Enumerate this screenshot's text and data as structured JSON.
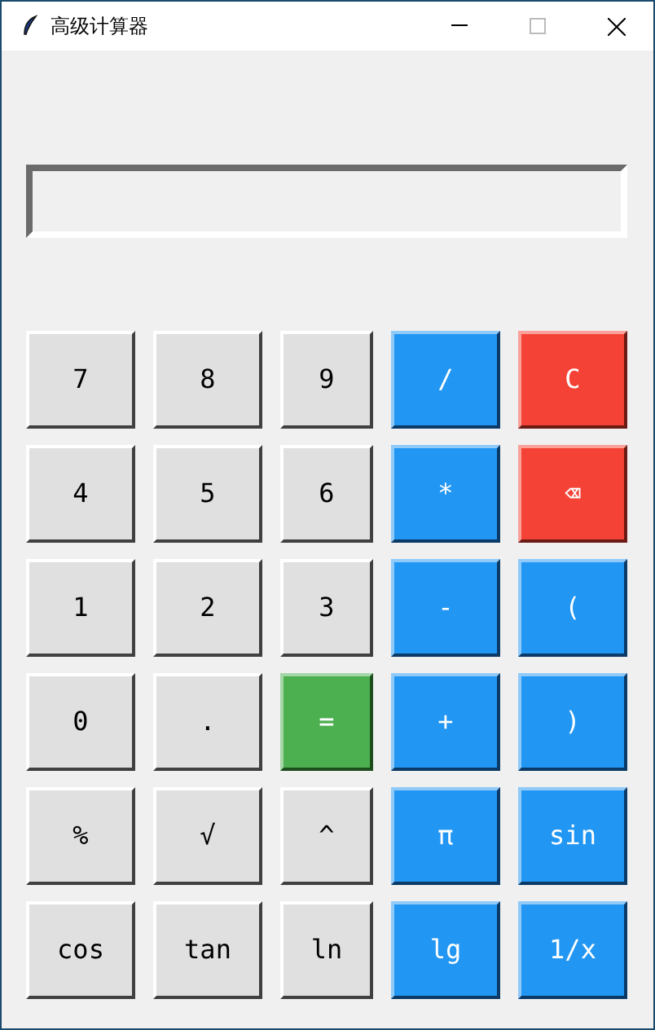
{
  "window": {
    "title": "高级计算器"
  },
  "buttons": [
    {
      "label": "7",
      "kind": "plain"
    },
    {
      "label": "8",
      "kind": "plain"
    },
    {
      "label": "9",
      "kind": "plain"
    },
    {
      "label": "/",
      "kind": "operator"
    },
    {
      "label": "C",
      "kind": "clear"
    },
    {
      "label": "4",
      "kind": "plain"
    },
    {
      "label": "5",
      "kind": "plain"
    },
    {
      "label": "6",
      "kind": "plain"
    },
    {
      "label": "*",
      "kind": "operator"
    },
    {
      "label": "⌫",
      "kind": "clear"
    },
    {
      "label": "1",
      "kind": "plain"
    },
    {
      "label": "2",
      "kind": "plain"
    },
    {
      "label": "3",
      "kind": "plain"
    },
    {
      "label": "-",
      "kind": "operator"
    },
    {
      "label": "(",
      "kind": "operator"
    },
    {
      "label": "0",
      "kind": "plain"
    },
    {
      "label": ".",
      "kind": "plain"
    },
    {
      "label": "=",
      "kind": "equals"
    },
    {
      "label": "+",
      "kind": "operator"
    },
    {
      "label": ")",
      "kind": "operator"
    },
    {
      "label": "%",
      "kind": "plain"
    },
    {
      "label": "√",
      "kind": "plain"
    },
    {
      "label": "^",
      "kind": "plain"
    },
    {
      "label": "π",
      "kind": "operator"
    },
    {
      "label": "sin",
      "kind": "operator"
    },
    {
      "label": "cos",
      "kind": "plain"
    },
    {
      "label": "tan",
      "kind": "plain"
    },
    {
      "label": "ln",
      "kind": "plain"
    },
    {
      "label": "lg",
      "kind": "operator"
    },
    {
      "label": "1/x",
      "kind": "operator"
    }
  ]
}
